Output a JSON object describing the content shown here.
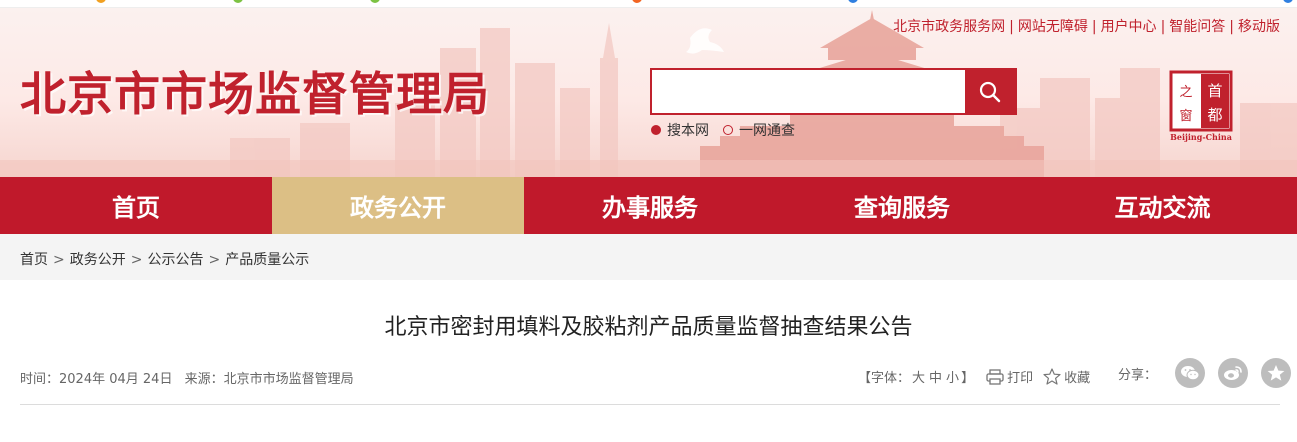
{
  "header": {
    "site_title": "北京市市场监督管理局",
    "top_links": [
      "北京市政务服务网",
      "网站无障碍",
      "用户中心",
      "智能问答",
      "移动版"
    ],
    "seal_top": "首",
    "seal_right": "都",
    "seal_left_top": "之",
    "seal_left_bottom": "窗",
    "seal_caption": "Beijing-China"
  },
  "search": {
    "placeholder": "",
    "value": "",
    "scope_options": [
      {
        "label": "搜本网",
        "selected": true
      },
      {
        "label": "一网通查",
        "selected": false
      }
    ]
  },
  "nav": {
    "items": [
      {
        "label": "首页",
        "active": false
      },
      {
        "label": "政务公开",
        "active": true
      },
      {
        "label": "办事服务",
        "active": false
      },
      {
        "label": "查询服务",
        "active": false
      },
      {
        "label": "互动交流",
        "active": false
      }
    ]
  },
  "breadcrumb": [
    "首页",
    "政务公开",
    "公示公告",
    "产品质量公示"
  ],
  "article": {
    "title": "北京市密封用填料及胶粘剂产品质量监督抽查结果公告",
    "time_label": "时间：",
    "time": "2024年 04月 24日",
    "source_label": "来源：",
    "source": "北京市市场监督管理局",
    "font_label_open": "【字体：",
    "font_large": "大",
    "font_medium": "中",
    "font_small": "小",
    "font_label_close": "】",
    "print_label": "打印",
    "fav_label": "收藏",
    "share_label": "分享："
  },
  "colors": {
    "brand_red": "#c0192b",
    "nav_active": "#dcbf85"
  },
  "icons": [
    "search-icon",
    "print-icon",
    "star-icon",
    "wechat-icon",
    "weibo-icon",
    "qq-icon"
  ]
}
